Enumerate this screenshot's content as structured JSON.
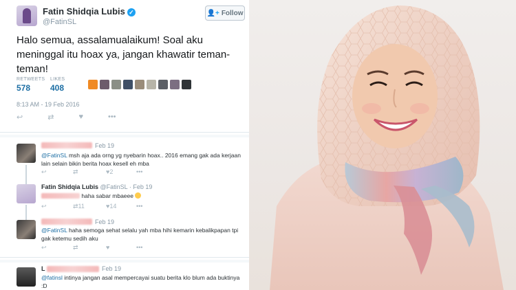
{
  "main_tweet": {
    "name": "Fatin Shidqia Lubis",
    "handle": "@FatinSL",
    "follow_label": "Follow",
    "text": "Halo semua, assalamualaikum! Soal aku meninggal itu hoax ya, jangan khawatir teman-teman!",
    "retweets_label": "RETWEETS",
    "retweets": "578",
    "likes_label": "LIKES",
    "likes": "408",
    "timestamp": "8:13 AM - 19 Feb 2016"
  },
  "replies": [
    {
      "date": "Feb 19",
      "mention": "@FatinSL",
      "text": " msh aja ada orng yg nyebarin hoax.. 2016 emang gak ada kerjaan lain selain bikin berita hoax kesell eh mba",
      "likes": "2"
    },
    {
      "name": "Fatin Shidqia Lubis",
      "handle_date": "@FatinSL · Feb 19",
      "text": " haha sabar mbaeee",
      "retweets": "11",
      "likes": "14"
    },
    {
      "date": "Feb 19",
      "mention": "@FatinSL",
      "text": " haha semoga sehat selalu yah mba hihi kemarin kebalikpapan tpi gak ketemu sedih aku"
    },
    {
      "name_prefix": "L",
      "date": "Feb 19",
      "mention": "@fatinsl",
      "text": " intinya jangan asal mempercayai suatu berita klo blum ada buktinya :D"
    }
  ]
}
